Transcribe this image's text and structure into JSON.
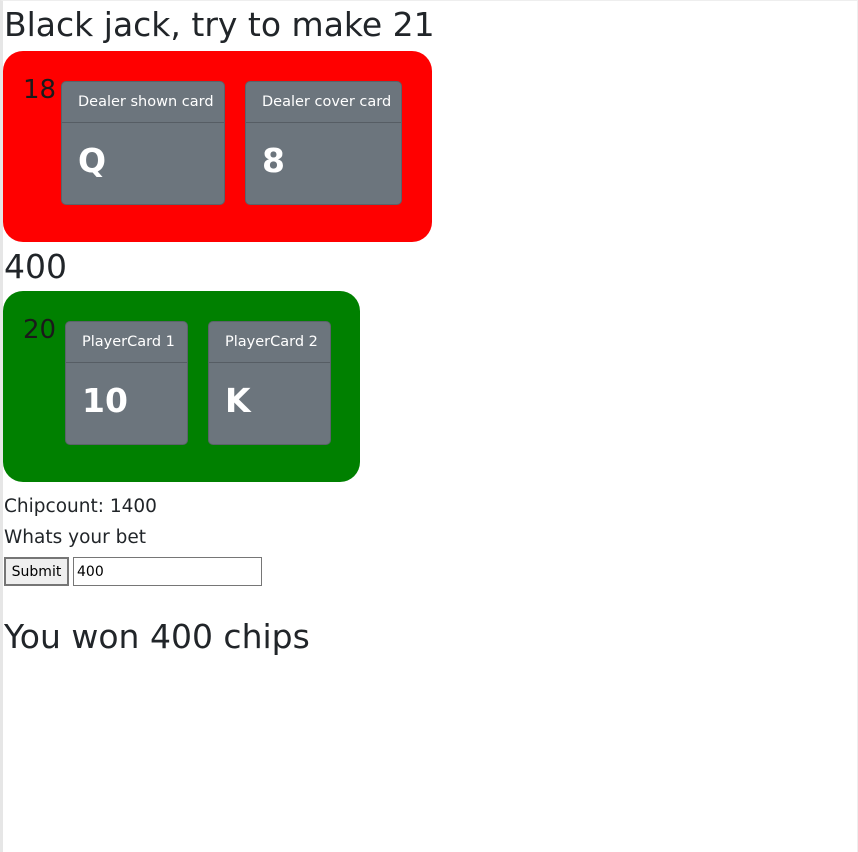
{
  "title": "Black jack, try to make 21",
  "dealer": {
    "total": "18",
    "cards": [
      {
        "header": "Dealer shown card",
        "value": "Q"
      },
      {
        "header": "Dealer cover card",
        "value": "8"
      }
    ]
  },
  "bet_amount": "400",
  "player": {
    "total": "20",
    "cards": [
      {
        "header": "PlayerCard 1",
        "value": "10"
      },
      {
        "header": "PlayerCard 2",
        "value": "K"
      }
    ]
  },
  "chipcount": "Chipcount: 1400",
  "prompt": "Whats your bet",
  "form": {
    "submit_label": "Submit",
    "bet_value": "400"
  },
  "result": "You won 400 chips",
  "colors": {
    "dealer_board": "#ff0000",
    "player_board": "#008000",
    "card": "#6c757d"
  }
}
